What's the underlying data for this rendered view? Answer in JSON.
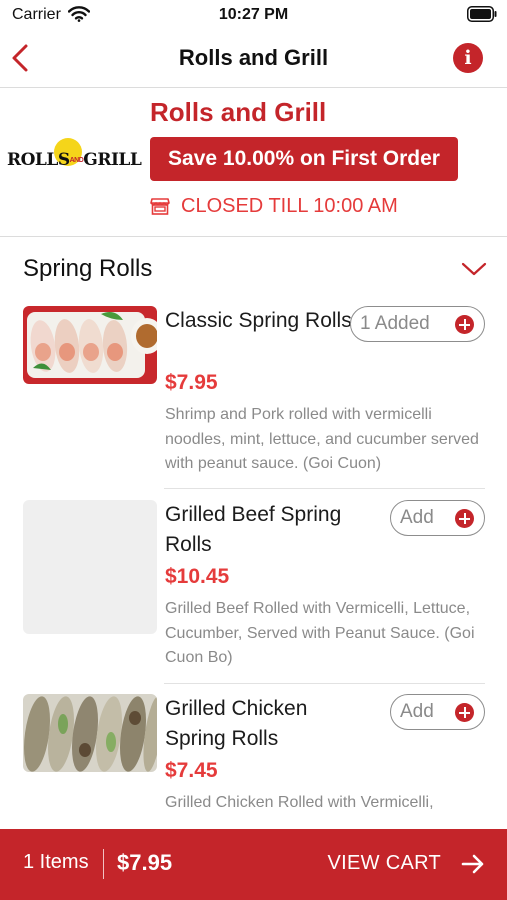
{
  "status_bar": {
    "carrier": "Carrier",
    "time": "10:27 PM"
  },
  "nav": {
    "title": "Rolls and Grill",
    "back_icon": "chevron-left-icon",
    "info_icon": "info-icon",
    "info_glyph": "i"
  },
  "restaurant": {
    "name": "Rolls and Grill",
    "logo_text_left": "ROLLS",
    "logo_text_and": "AND",
    "logo_text_right": "GRILL",
    "promo": "Save 10.00% on First Order",
    "status": "CLOSED TILL 10:00 AM",
    "status_icon": "storefront-icon"
  },
  "section": {
    "title": "Spring Rolls",
    "expanded": true
  },
  "items": [
    {
      "name": "Classic Spring Rolls",
      "price": "$7.95",
      "description": "Shrimp and Pork rolled with vermicelli noodles, mint, lettuce, and cucumber served with peanut sauce. (Goi Cuon)",
      "button_label": "1 Added",
      "has_image": true
    },
    {
      "name": "Grilled Beef Spring Rolls",
      "price": "$10.45",
      "description": "Grilled Beef Rolled with Vermicelli, Lettuce, Cucumber, Served with Peanut Sauce. (Goi Cuon Bo)",
      "button_label": "Add",
      "has_image": false
    },
    {
      "name": "Grilled Chicken Spring Rolls",
      "price": "$7.45",
      "description": "Grilled Chicken Rolled with Vermicelli,",
      "button_label": "Add",
      "has_image": true
    }
  ],
  "cart": {
    "count_label": "1 Items",
    "total": "$7.95",
    "action": "VIEW CART"
  },
  "colors": {
    "brand": "#c4252a",
    "price": "#e53b3b",
    "muted": "#8a8a8a"
  }
}
